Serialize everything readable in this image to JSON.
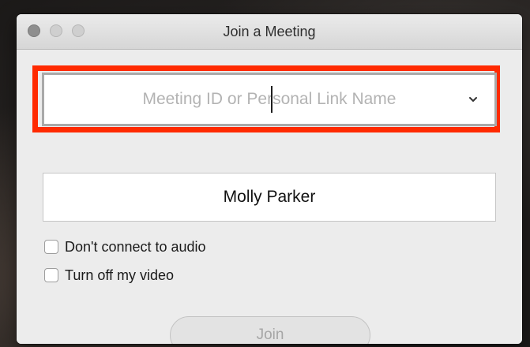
{
  "window": {
    "title": "Join a Meeting"
  },
  "meeting_field": {
    "placeholder": "Meeting ID or Personal Link Name",
    "dropdown_icon": "chevron-down-icon"
  },
  "name_field": {
    "value": "Molly Parker"
  },
  "options": [
    {
      "label": "Don't connect to audio",
      "checked": false
    },
    {
      "label": "Turn off my video",
      "checked": false
    }
  ],
  "join_button": {
    "label": "Join",
    "enabled": false
  },
  "colors": {
    "highlight": "#ff2a00"
  }
}
